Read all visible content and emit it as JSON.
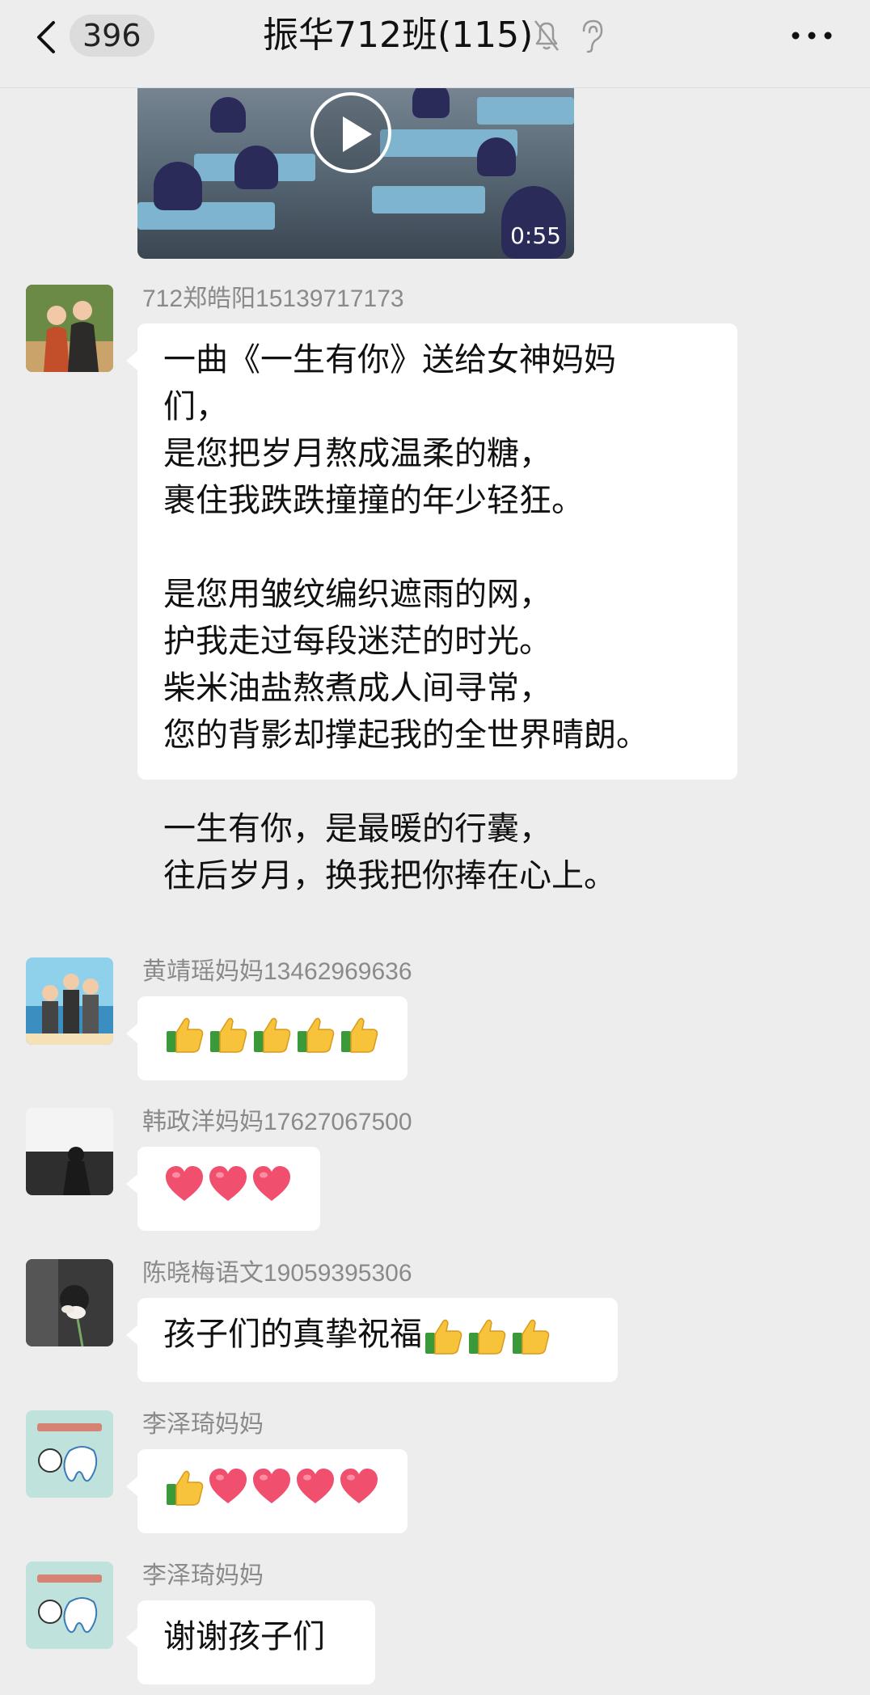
{
  "header": {
    "unread_count": "396",
    "title": "振华712班(115)"
  },
  "video": {
    "duration": "0:55"
  },
  "messages": [
    {
      "sender": "712郑皓阳15139717173",
      "lines": [
        "一曲《一生有你》送给女神妈妈",
        "们，",
        "是您把岁月熬成温柔的糖，",
        "裹住我跌跌撞撞的年少轻狂。",
        "",
        "是您用皱纹编织遮雨的网，",
        "护我走过每段迷茫的时光。",
        "柴米油盐熬煮成人间寻常，",
        "您的背影却撑起我的全世界晴朗。",
        "",
        "一生有你，是最暖的行囊，",
        "往后岁月，换我把你捧在心上。"
      ]
    },
    {
      "sender": "黄靖瑶妈妈13462969636",
      "emojis": [
        "thumbs-up",
        "thumbs-up",
        "thumbs-up",
        "thumbs-up",
        "thumbs-up"
      ]
    },
    {
      "sender": "韩政洋妈妈17627067500",
      "emojis": [
        "heart",
        "heart",
        "heart"
      ]
    },
    {
      "sender": "陈晓梅语文19059395306",
      "text": "孩子们的真挚祝福",
      "emojis": [
        "thumbs-up",
        "thumbs-up",
        "thumbs-up"
      ]
    },
    {
      "sender": "李泽琦妈妈",
      "emojis": [
        "thumbs-up",
        "heart",
        "heart",
        "heart",
        "heart"
      ]
    },
    {
      "sender": "李泽琦妈妈",
      "text": "谢谢孩子们"
    }
  ],
  "colors": {
    "background": "#ededed",
    "bubble": "#ffffff",
    "sender_name": "#8a8a8a"
  }
}
